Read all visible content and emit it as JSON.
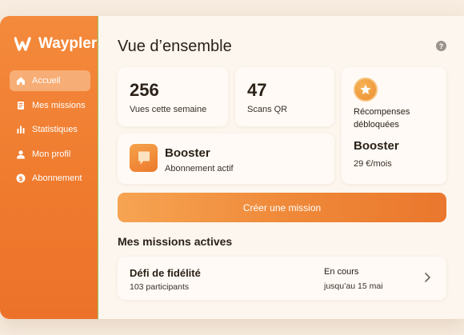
{
  "app": {
    "name": "Waypler"
  },
  "sidebar": {
    "items": [
      {
        "label": "Accueil",
        "icon": "home-icon",
        "active": true
      },
      {
        "label": "Mes missions",
        "icon": "document-icon",
        "active": false
      },
      {
        "label": "Statistiques",
        "icon": "bar-chart-icon",
        "active": false
      },
      {
        "label": "Mon profil",
        "icon": "user-icon",
        "active": false
      },
      {
        "label": "Abonnement",
        "icon": "dollar-icon",
        "active": false
      }
    ]
  },
  "header": {
    "title": "Vue d’ensemble",
    "help_icon": "question-icon"
  },
  "stats": [
    {
      "value": "256",
      "label": "Vues cette semaine"
    },
    {
      "value": "47",
      "label": "Scans QR"
    }
  ],
  "reward": {
    "icon": "star-badge-icon",
    "title": "Récompenses débloquées",
    "plan": "Booster",
    "price": "29 €/mois"
  },
  "subscription": {
    "icon": "booster-icon",
    "title": "Booster",
    "status": "Abonnement actif"
  },
  "cta": {
    "label": "Créer une mission"
  },
  "missions": {
    "title": "Mes missions actives",
    "items": [
      {
        "name": "Défi de fidélité",
        "participants": "103 participants",
        "status": "En cours",
        "deadline": "jusqu’au 15 mai"
      }
    ]
  },
  "colors": {
    "accent": "#f07f32",
    "background": "#fcf6ef",
    "card": "#fffaf5"
  }
}
